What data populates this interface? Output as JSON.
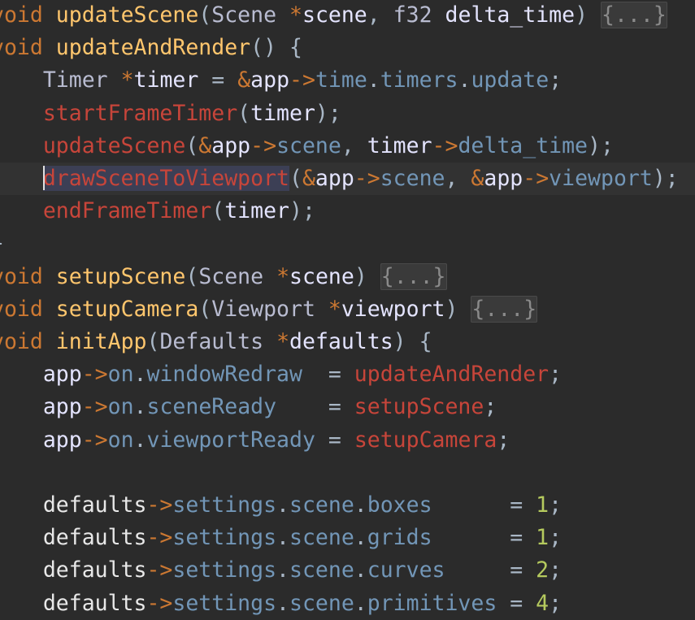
{
  "editor": {
    "lines": [
      {
        "segments": [
          {
            "t": "void",
            "c": "kw"
          },
          {
            "t": " ",
            "c": "op"
          },
          {
            "t": "updateScene",
            "c": "fn"
          },
          {
            "t": "(",
            "c": "op"
          },
          {
            "t": "Scene",
            "c": "type"
          },
          {
            "t": " ",
            "c": "op"
          },
          {
            "t": "*",
            "c": "ptr"
          },
          {
            "t": "scene",
            "c": "var"
          },
          {
            "t": ", ",
            "c": "op"
          },
          {
            "t": "f32",
            "c": "type"
          },
          {
            "t": " ",
            "c": "op"
          },
          {
            "t": "delta_time",
            "c": "var"
          },
          {
            "t": ") ",
            "c": "op"
          },
          {
            "t": "{...}",
            "c": "fold"
          }
        ]
      },
      {
        "segments": [
          {
            "t": "void",
            "c": "kw"
          },
          {
            "t": " ",
            "c": "op"
          },
          {
            "t": "updateAndRender",
            "c": "fn"
          },
          {
            "t": "() {",
            "c": "op"
          }
        ]
      },
      {
        "segments": [
          {
            "t": "    ",
            "c": "op"
          },
          {
            "t": "Timer",
            "c": "type"
          },
          {
            "t": " ",
            "c": "op"
          },
          {
            "t": "*",
            "c": "ptr"
          },
          {
            "t": "timer",
            "c": "var"
          },
          {
            "t": " = ",
            "c": "op"
          },
          {
            "t": "&",
            "c": "ptr"
          },
          {
            "t": "app",
            "c": "var"
          },
          {
            "t": "->",
            "c": "ptr"
          },
          {
            "t": "time",
            "c": "field"
          },
          {
            "t": ".",
            "c": "op"
          },
          {
            "t": "timers",
            "c": "field"
          },
          {
            "t": ".",
            "c": "op"
          },
          {
            "t": "update",
            "c": "field"
          },
          {
            "t": ";",
            "c": "op"
          }
        ]
      },
      {
        "segments": [
          {
            "t": "    ",
            "c": "op"
          },
          {
            "t": "startFrameTimer",
            "c": "call"
          },
          {
            "t": "(",
            "c": "op"
          },
          {
            "t": "timer",
            "c": "var"
          },
          {
            "t": ");",
            "c": "op"
          }
        ]
      },
      {
        "segments": [
          {
            "t": "    ",
            "c": "op"
          },
          {
            "t": "updateScene",
            "c": "call"
          },
          {
            "t": "(",
            "c": "op"
          },
          {
            "t": "&",
            "c": "ptr"
          },
          {
            "t": "app",
            "c": "var"
          },
          {
            "t": "->",
            "c": "ptr"
          },
          {
            "t": "scene",
            "c": "field"
          },
          {
            "t": ", ",
            "c": "op"
          },
          {
            "t": "timer",
            "c": "var"
          },
          {
            "t": "->",
            "c": "ptr"
          },
          {
            "t": "delta_time",
            "c": "field"
          },
          {
            "t": ");",
            "c": "op"
          }
        ]
      },
      {
        "current": true,
        "segments": [
          {
            "t": "    ",
            "c": "op"
          },
          {
            "t": "drawSceneToViewport",
            "c": "call",
            "selected": true,
            "caret": true
          },
          {
            "t": "(",
            "c": "op"
          },
          {
            "t": "&",
            "c": "ptr"
          },
          {
            "t": "app",
            "c": "var"
          },
          {
            "t": "->",
            "c": "ptr"
          },
          {
            "t": "scene",
            "c": "field"
          },
          {
            "t": ", ",
            "c": "op"
          },
          {
            "t": "&",
            "c": "ptr"
          },
          {
            "t": "app",
            "c": "var"
          },
          {
            "t": "->",
            "c": "ptr"
          },
          {
            "t": "viewport",
            "c": "field"
          },
          {
            "t": ");",
            "c": "op"
          }
        ]
      },
      {
        "segments": [
          {
            "t": "    ",
            "c": "op"
          },
          {
            "t": "endFrameTimer",
            "c": "call"
          },
          {
            "t": "(",
            "c": "op"
          },
          {
            "t": "timer",
            "c": "var"
          },
          {
            "t": ");",
            "c": "op"
          }
        ]
      },
      {
        "segments": [
          {
            "t": "}",
            "c": "op"
          }
        ]
      },
      {
        "segments": [
          {
            "t": "void",
            "c": "kw"
          },
          {
            "t": " ",
            "c": "op"
          },
          {
            "t": "setupScene",
            "c": "fn"
          },
          {
            "t": "(",
            "c": "op"
          },
          {
            "t": "Scene",
            "c": "type"
          },
          {
            "t": " ",
            "c": "op"
          },
          {
            "t": "*",
            "c": "ptr"
          },
          {
            "t": "scene",
            "c": "var"
          },
          {
            "t": ") ",
            "c": "op"
          },
          {
            "t": "{...}",
            "c": "fold"
          }
        ]
      },
      {
        "segments": [
          {
            "t": "void",
            "c": "kw"
          },
          {
            "t": " ",
            "c": "op"
          },
          {
            "t": "setupCamera",
            "c": "fn"
          },
          {
            "t": "(",
            "c": "op"
          },
          {
            "t": "Viewport",
            "c": "type"
          },
          {
            "t": " ",
            "c": "op"
          },
          {
            "t": "*",
            "c": "ptr"
          },
          {
            "t": "viewport",
            "c": "var"
          },
          {
            "t": ") ",
            "c": "op"
          },
          {
            "t": "{...}",
            "c": "fold"
          }
        ]
      },
      {
        "segments": [
          {
            "t": "void",
            "c": "kw"
          },
          {
            "t": " ",
            "c": "op"
          },
          {
            "t": "initApp",
            "c": "fn"
          },
          {
            "t": "(",
            "c": "op"
          },
          {
            "t": "Defaults",
            "c": "type"
          },
          {
            "t": " ",
            "c": "op"
          },
          {
            "t": "*",
            "c": "ptr"
          },
          {
            "t": "defaults",
            "c": "var"
          },
          {
            "t": ") {",
            "c": "op"
          }
        ]
      },
      {
        "segments": [
          {
            "t": "    ",
            "c": "op"
          },
          {
            "t": "app",
            "c": "var"
          },
          {
            "t": "->",
            "c": "ptr"
          },
          {
            "t": "on",
            "c": "field"
          },
          {
            "t": ".",
            "c": "op"
          },
          {
            "t": "windowRedraw",
            "c": "field"
          },
          {
            "t": "  = ",
            "c": "op"
          },
          {
            "t": "updateAndRender",
            "c": "call"
          },
          {
            "t": ";",
            "c": "op"
          }
        ]
      },
      {
        "segments": [
          {
            "t": "    ",
            "c": "op"
          },
          {
            "t": "app",
            "c": "var"
          },
          {
            "t": "->",
            "c": "ptr"
          },
          {
            "t": "on",
            "c": "field"
          },
          {
            "t": ".",
            "c": "op"
          },
          {
            "t": "sceneReady",
            "c": "field"
          },
          {
            "t": "    = ",
            "c": "op"
          },
          {
            "t": "setupScene",
            "c": "call"
          },
          {
            "t": ";",
            "c": "op"
          }
        ]
      },
      {
        "segments": [
          {
            "t": "    ",
            "c": "op"
          },
          {
            "t": "app",
            "c": "var"
          },
          {
            "t": "->",
            "c": "ptr"
          },
          {
            "t": "on",
            "c": "field"
          },
          {
            "t": ".",
            "c": "op"
          },
          {
            "t": "viewportReady",
            "c": "field"
          },
          {
            "t": " = ",
            "c": "op"
          },
          {
            "t": "setupCamera",
            "c": "call"
          },
          {
            "t": ";",
            "c": "op"
          }
        ]
      },
      {
        "segments": []
      },
      {
        "segments": [
          {
            "t": "    ",
            "c": "op"
          },
          {
            "t": "defaults",
            "c": "def"
          },
          {
            "t": "->",
            "c": "ptr"
          },
          {
            "t": "settings",
            "c": "field"
          },
          {
            "t": ".",
            "c": "op"
          },
          {
            "t": "scene",
            "c": "field"
          },
          {
            "t": ".",
            "c": "op"
          },
          {
            "t": "boxes",
            "c": "field"
          },
          {
            "t": "      = ",
            "c": "op"
          },
          {
            "t": "1",
            "c": "num"
          },
          {
            "t": ";",
            "c": "op"
          }
        ]
      },
      {
        "segments": [
          {
            "t": "    ",
            "c": "op"
          },
          {
            "t": "defaults",
            "c": "def"
          },
          {
            "t": "->",
            "c": "ptr"
          },
          {
            "t": "settings",
            "c": "field"
          },
          {
            "t": ".",
            "c": "op"
          },
          {
            "t": "scene",
            "c": "field"
          },
          {
            "t": ".",
            "c": "op"
          },
          {
            "t": "grids",
            "c": "field"
          },
          {
            "t": "      = ",
            "c": "op"
          },
          {
            "t": "1",
            "c": "num"
          },
          {
            "t": ";",
            "c": "op"
          }
        ]
      },
      {
        "segments": [
          {
            "t": "    ",
            "c": "op"
          },
          {
            "t": "defaults",
            "c": "def"
          },
          {
            "t": "->",
            "c": "ptr"
          },
          {
            "t": "settings",
            "c": "field"
          },
          {
            "t": ".",
            "c": "op"
          },
          {
            "t": "scene",
            "c": "field"
          },
          {
            "t": ".",
            "c": "op"
          },
          {
            "t": "curves",
            "c": "field"
          },
          {
            "t": "     = ",
            "c": "op"
          },
          {
            "t": "2",
            "c": "num"
          },
          {
            "t": ";",
            "c": "op"
          }
        ]
      },
      {
        "segments": [
          {
            "t": "    ",
            "c": "op"
          },
          {
            "t": "defaults",
            "c": "def"
          },
          {
            "t": "->",
            "c": "ptr"
          },
          {
            "t": "settings",
            "c": "field"
          },
          {
            "t": ".",
            "c": "op"
          },
          {
            "t": "scene",
            "c": "field"
          },
          {
            "t": ".",
            "c": "op"
          },
          {
            "t": "primitives",
            "c": "field"
          },
          {
            "t": " = ",
            "c": "op"
          },
          {
            "t": "4",
            "c": "num"
          },
          {
            "t": ";",
            "c": "op"
          }
        ]
      }
    ]
  },
  "colors": {
    "background": "#2b2b2b",
    "keyword": "#cc7832",
    "function_def": "#ffc66d",
    "function_call": "#c7453a",
    "field": "#7296b7",
    "number": "#b5ca5e",
    "type": "#b9bcd1",
    "variable": "#e4e4ff"
  }
}
